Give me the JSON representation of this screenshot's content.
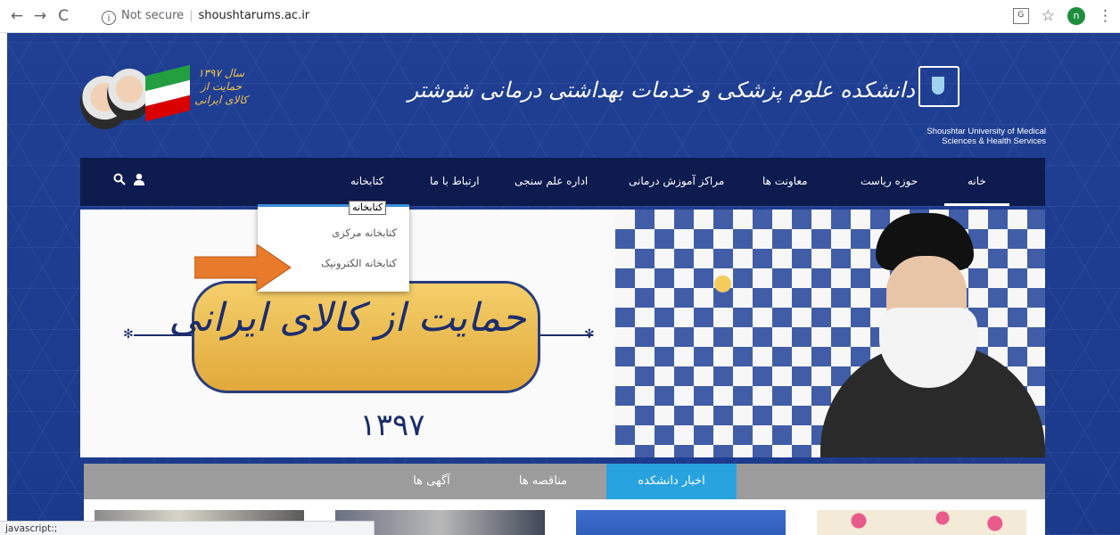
{
  "browser": {
    "url_security": "Not secure",
    "url": "shoushtarums.ac.ir",
    "profile_initial": "n"
  },
  "header": {
    "university_fa": "دانشکده علوم پزشکی و خدمات بهداشتی درمانی شوشتر",
    "university_en_line1": "Shoushtar University of Medical",
    "university_en_line2": "Sciences & Health Services",
    "slogan_small": "سال ۱۳۹۷ حمایت از کالای ایرانی"
  },
  "nav": {
    "items": [
      "خانه",
      "حوزه ریاست",
      "معاونت ها",
      "مراکز آموزش درمانی",
      "اداره علم سنجی",
      "ارتباط با ما",
      "کتابخانه"
    ],
    "active": "خانه"
  },
  "dropdown": {
    "tooltip": "کتابخانه",
    "items": [
      "کتابخانه مرکزی",
      "کتابخانه الکترونیک"
    ]
  },
  "banner": {
    "slogan": "حمایت از کالای ایرانی",
    "year": "۱۳۹۷"
  },
  "tabs": [
    "اخبار دانشکده",
    "مناقصه ها",
    "آگهی ها"
  ],
  "status_bar": "javascript:;",
  "colors": {
    "nav_bg": "#0e1b4f",
    "site_bg": "#1f3f93",
    "tab_active": "#29a3e0",
    "arrow": "#e77a2b"
  }
}
